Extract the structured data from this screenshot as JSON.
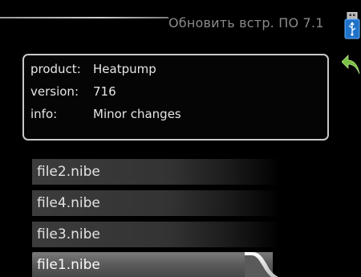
{
  "header": {
    "title": "Обновить встр. ПО 7.1",
    "usb_icon": "usb-icon",
    "back_icon": "back-arrow-icon"
  },
  "info": {
    "rows": [
      {
        "key": "product:",
        "value": "Heatpump"
      },
      {
        "key": "version:",
        "value": "716"
      },
      {
        "key": "info:",
        "value": "Minor changes"
      }
    ]
  },
  "files": {
    "items": [
      "file2.nibe",
      "file4.nibe",
      "file3.nibe",
      "file1.nibe"
    ],
    "selected": "file1.nibe"
  },
  "colors": {
    "background": "#000000",
    "text": "#e8e8e8",
    "title": "#8a8a8a",
    "usb_blue": "#1e73c8",
    "arrow_green": "#7ac043"
  }
}
